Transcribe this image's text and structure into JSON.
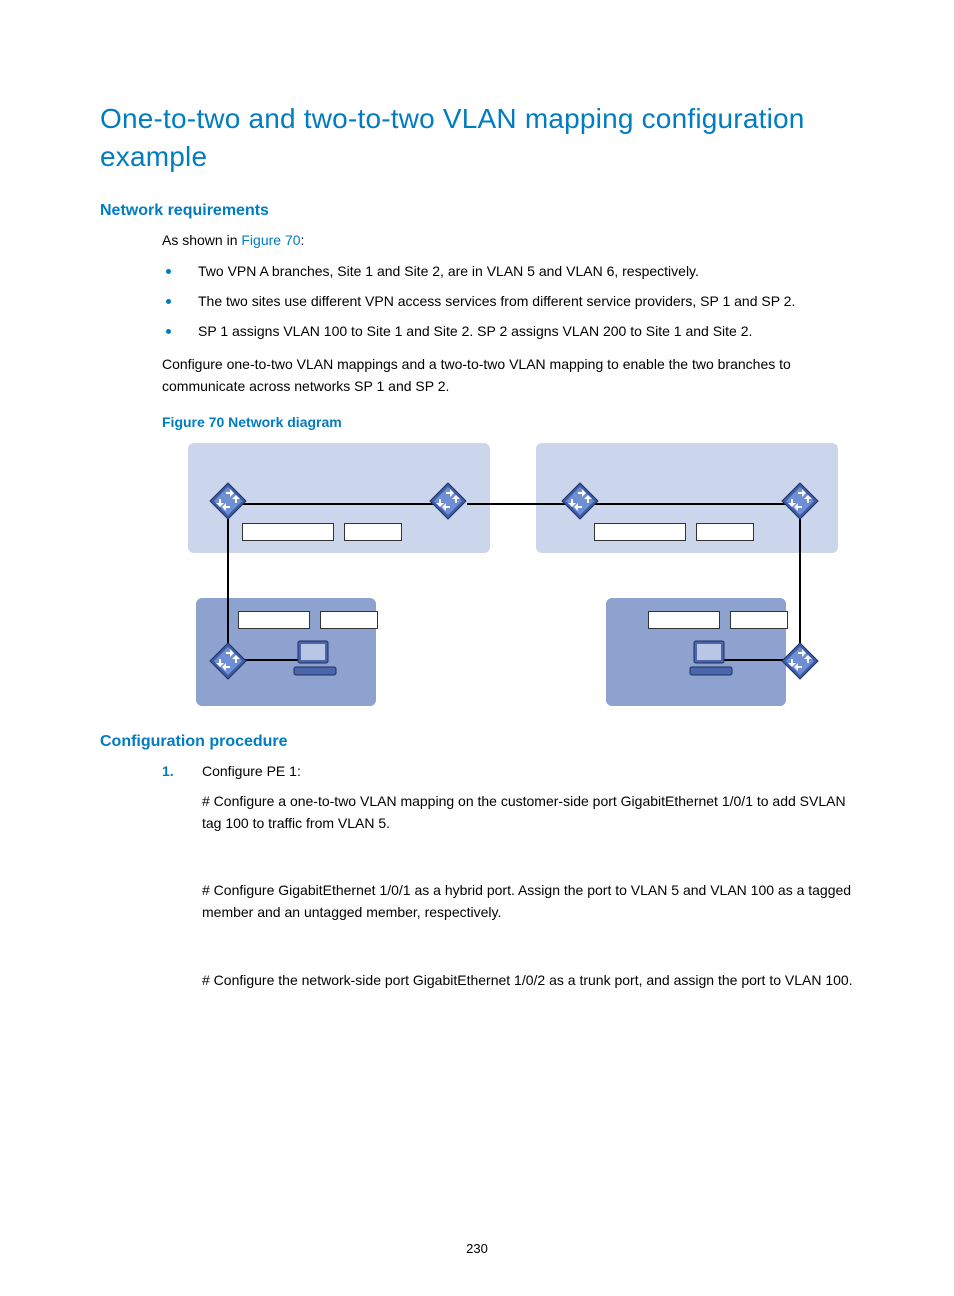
{
  "title": "One-to-two and two-to-two VLAN mapping configuration example",
  "sections": {
    "network_req": {
      "heading": "Network requirements",
      "intro_prefix": "As shown in ",
      "intro_link": "Figure 70",
      "intro_suffix": ":",
      "bullets": [
        "Two VPN A branches, Site 1 and Site 2, are in VLAN 5 and VLAN 6, respectively.",
        "The two sites use different VPN access services from different service providers, SP 1 and SP 2.",
        "SP 1 assigns VLAN 100 to Site 1 and Site 2. SP 2 assigns VLAN 200 to Site 1 and Site 2."
      ],
      "summary": "Configure one-to-two VLAN mappings and a two-to-two VLAN mapping to enable the two branches to communicate across networks SP 1 and SP 2.",
      "figure_caption": "Figure 70 Network diagram"
    },
    "config_proc": {
      "heading": "Configuration procedure",
      "steps": [
        {
          "title": "Configure PE 1:",
          "paras": [
            "# Configure a one-to-two VLAN mapping on the customer-side port GigabitEthernet 1/0/1 to add SVLAN tag 100 to traffic from VLAN 5.",
            "# Configure GigabitEthernet 1/0/1 as a hybrid port. Assign the port to VLAN 5 and VLAN 100 as a tagged member and an untagged member, respectively.",
            "# Configure the network-side port GigabitEthernet 1/0/2 as a trunk port, and assign the port to VLAN 100."
          ]
        }
      ]
    }
  },
  "page_number": "230"
}
